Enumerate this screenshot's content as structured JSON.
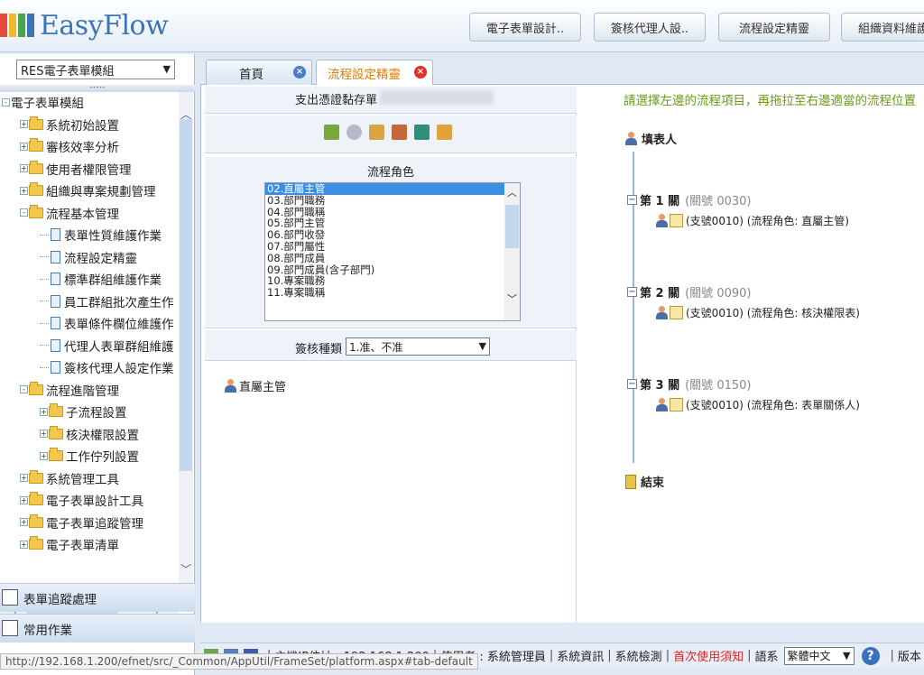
{
  "app": {
    "logo_text": "EasyFlow",
    "logo_colors": [
      "#e84b3c",
      "#f2b630",
      "#4aa54b",
      "#3d74b8"
    ]
  },
  "header": {
    "buttons": [
      {
        "label": "電子表單設計.."
      },
      {
        "label": "簽核代理人設.."
      },
      {
        "label": "流程設定精靈"
      },
      {
        "label": "組織資料維護"
      }
    ]
  },
  "sidebar": {
    "module_select": "RES電子表單模組",
    "tree": [
      {
        "label": "電子表單模組",
        "level": 0,
        "type": "root",
        "expander": "-"
      },
      {
        "label": "系統初始設置",
        "level": 1,
        "type": "folder",
        "expander": "+"
      },
      {
        "label": "審核效率分析",
        "level": 1,
        "type": "folder",
        "expander": "+"
      },
      {
        "label": "使用者權限管理",
        "level": 1,
        "type": "folder",
        "expander": "+"
      },
      {
        "label": "組織與專案規劃管理",
        "level": 1,
        "type": "folder",
        "expander": "+"
      },
      {
        "label": "流程基本管理",
        "level": 1,
        "type": "folder",
        "expander": "-"
      },
      {
        "label": "表單性質維護作業",
        "level": 2,
        "type": "doc",
        "expander": ""
      },
      {
        "label": "流程設定精靈",
        "level": 2,
        "type": "doc",
        "expander": ""
      },
      {
        "label": "標準群組維護作業",
        "level": 2,
        "type": "doc",
        "expander": ""
      },
      {
        "label": "員工群組批次產生作",
        "level": 2,
        "type": "doc",
        "expander": ""
      },
      {
        "label": "表單條件欄位維護作",
        "level": 2,
        "type": "doc",
        "expander": ""
      },
      {
        "label": "代理人表單群組維護",
        "level": 2,
        "type": "doc",
        "expander": ""
      },
      {
        "label": "簽核代理人設定作業",
        "level": 2,
        "type": "doc",
        "expander": ""
      },
      {
        "label": "流程進階管理",
        "level": 1,
        "type": "folder",
        "expander": "-"
      },
      {
        "label": "子流程設置",
        "level": 2,
        "type": "folder",
        "expander": "+"
      },
      {
        "label": "核決權限設置",
        "level": 2,
        "type": "folder",
        "expander": "+"
      },
      {
        "label": "工作佇列設置",
        "level": 2,
        "type": "folder",
        "expander": "+"
      },
      {
        "label": "系統管理工具",
        "level": 1,
        "type": "folder",
        "expander": "+"
      },
      {
        "label": "電子表單設計工具",
        "level": 1,
        "type": "folder",
        "expander": "+"
      },
      {
        "label": "電子表單追蹤管理",
        "level": 1,
        "type": "folder",
        "expander": "+"
      },
      {
        "label": "電子表單清單",
        "level": 1,
        "type": "folder",
        "expander": "+"
      }
    ],
    "accordion": [
      {
        "label": "表單追蹤處理"
      },
      {
        "label": "常用作業"
      }
    ]
  },
  "tabs": [
    {
      "label": "首頁",
      "active": false
    },
    {
      "label": "流程設定精靈",
      "active": true
    }
  ],
  "wizard": {
    "form_title": "支出憑證黏存單",
    "role_title": "流程角色",
    "roles": [
      "02.直屬主管",
      "03.部門職務",
      "04.部門職稱",
      "05.部門主管",
      "06.部門收發",
      "07.部門屬性",
      "08.部門成員",
      "09.部門成員(含子部門)",
      "10.專案職務",
      "11.專案職稱"
    ],
    "approve_type_label": "簽核種類",
    "approve_type_value": "1.准、不准",
    "selected_role_preview": "直屬主管"
  },
  "flow": {
    "hint": "請選擇左邊的流程項目，再拖拉至右邊適當的流程位置",
    "start": "填表人",
    "steps": [
      {
        "title": "第 1 關",
        "code": "(關號 0030)",
        "detail": "(支號0010) (流程角色: 直屬主管)"
      },
      {
        "title": "第 2 關",
        "code": "(關號 0090)",
        "detail": "(支號0010) (流程角色: 核決權限表)"
      },
      {
        "title": "第 3 關",
        "code": "(關號 0150)",
        "detail": "(支號0010) (流程角色: 表單關係人)"
      }
    ],
    "end": "結束"
  },
  "footer": {
    "host": "主機IP位址 : 192.168.1.200",
    "user": "使用者 : 系統管理員",
    "sysinfo": "系統資訊",
    "syscheck": "系統檢測",
    "first_use": "首次使用須知",
    "lang_label": "語系",
    "lang_value": "繁體中文",
    "version": "版本"
  },
  "status_url": "http://192.168.1.200/efnet/src/_Common/AppUtil/FrameSet/platform.aspx#tab-default"
}
